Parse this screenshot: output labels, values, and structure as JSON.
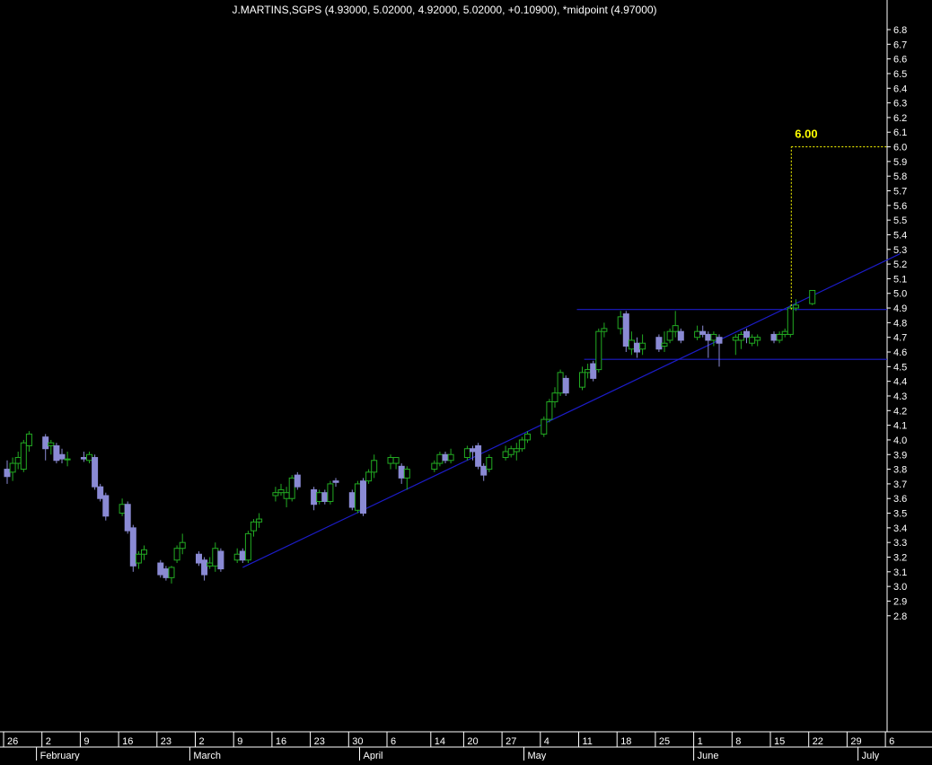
{
  "chart_data": {
    "type": "candlestick",
    "title": "J.MARTINS,SGPS (4.93000, 5.02000, 4.92000, 5.02000, +0.10900), *midpoint (4.97000)",
    "ylim": [
      2.75,
      6.95
    ],
    "yticks": [
      2.8,
      2.9,
      3.0,
      3.1,
      3.2,
      3.3,
      3.4,
      3.5,
      3.6,
      3.7,
      3.8,
      3.9,
      4.0,
      4.1,
      4.2,
      4.3,
      4.4,
      4.5,
      4.6,
      4.7,
      4.8,
      4.9,
      5.0,
      5.1,
      5.2,
      5.3,
      5.4,
      5.5,
      5.6,
      5.7,
      5.8,
      5.9,
      6.0,
      6.1,
      6.2,
      6.3,
      6.4,
      6.5,
      6.6,
      6.7,
      6.8
    ],
    "grid": false,
    "day_labels": [
      "26",
      "2",
      "9",
      "16",
      "23",
      "2",
      "9",
      "16",
      "23",
      "30",
      "6",
      "14",
      "20",
      "27",
      "4",
      "11",
      "18",
      "25",
      "1",
      "8",
      "15",
      "22",
      "29",
      "6"
    ],
    "month_labels": [
      "February",
      "March",
      "April",
      "May",
      "June",
      "July"
    ],
    "colors": {
      "up": "#22aa22",
      "down": "#8a8ad4",
      "trend": "#1c1cc8",
      "target": "#ffff00",
      "axis": "#ffffff"
    },
    "target_label": "6.00",
    "target_value": 6.0,
    "resistance": 4.89,
    "support": 4.55,
    "trendline": {
      "from": [
        "Mar 10",
        3.13
      ],
      "to": [
        "Jul 8",
        5.27
      ]
    },
    "candles": [
      {
        "d": "Jan 26",
        "o": 3.8,
        "h": 3.86,
        "l": 3.7,
        "c": 3.75
      },
      {
        "d": "Jan 27",
        "o": 3.78,
        "h": 3.88,
        "l": 3.72,
        "c": 3.84
      },
      {
        "d": "Jan 28",
        "o": 3.84,
        "h": 3.92,
        "l": 3.8,
        "c": 3.88
      },
      {
        "d": "Jan 29",
        "o": 3.8,
        "h": 4.0,
        "l": 3.78,
        "c": 3.98
      },
      {
        "d": "Jan 30",
        "o": 3.96,
        "h": 4.06,
        "l": 3.92,
        "c": 4.04
      },
      {
        "d": "Feb 2",
        "o": 4.02,
        "h": 4.04,
        "l": 3.86,
        "c": 3.94
      },
      {
        "d": "Feb 3",
        "o": 3.96,
        "h": 4.0,
        "l": 3.9,
        "c": 3.98
      },
      {
        "d": "Feb 4",
        "o": 3.96,
        "h": 3.98,
        "l": 3.84,
        "c": 3.86
      },
      {
        "d": "Feb 5",
        "o": 3.9,
        "h": 3.94,
        "l": 3.84,
        "c": 3.87
      },
      {
        "d": "Feb 6",
        "o": 3.87,
        "h": 3.92,
        "l": 3.82,
        "c": 3.87
      },
      {
        "d": "Feb 9",
        "o": 3.88,
        "h": 3.92,
        "l": 3.85,
        "c": 3.87
      },
      {
        "d": "Feb 10",
        "o": 3.86,
        "h": 3.92,
        "l": 3.84,
        "c": 3.9
      },
      {
        "d": "Feb 11",
        "o": 3.88,
        "h": 3.9,
        "l": 3.66,
        "c": 3.68
      },
      {
        "d": "Feb 12",
        "o": 3.68,
        "h": 3.7,
        "l": 3.58,
        "c": 3.6
      },
      {
        "d": "Feb 13",
        "o": 3.62,
        "h": 3.64,
        "l": 3.45,
        "c": 3.48
      },
      {
        "d": "Feb 16",
        "o": 3.5,
        "h": 3.6,
        "l": 3.48,
        "c": 3.56
      },
      {
        "d": "Feb 17",
        "o": 3.56,
        "h": 3.58,
        "l": 3.36,
        "c": 3.38
      },
      {
        "d": "Feb 18",
        "o": 3.4,
        "h": 3.42,
        "l": 3.1,
        "c": 3.14
      },
      {
        "d": "Feb 19",
        "o": 3.16,
        "h": 3.24,
        "l": 3.12,
        "c": 3.22
      },
      {
        "d": "Feb 20",
        "o": 3.22,
        "h": 3.28,
        "l": 3.18,
        "c": 3.25
      },
      {
        "d": "Feb 23",
        "o": 3.16,
        "h": 3.18,
        "l": 3.06,
        "c": 3.08
      },
      {
        "d": "Feb 24",
        "o": 3.12,
        "h": 3.14,
        "l": 3.04,
        "c": 3.06
      },
      {
        "d": "Feb 25",
        "o": 3.06,
        "h": 3.14,
        "l": 3.02,
        "c": 3.13
      },
      {
        "d": "Feb 26",
        "o": 3.18,
        "h": 3.28,
        "l": 3.16,
        "c": 3.26
      },
      {
        "d": "Feb 27",
        "o": 3.26,
        "h": 3.36,
        "l": 3.22,
        "c": 3.3
      },
      {
        "d": "Mar 2",
        "o": 3.22,
        "h": 3.24,
        "l": 3.14,
        "c": 3.16
      },
      {
        "d": "Mar 3",
        "o": 3.18,
        "h": 3.2,
        "l": 3.04,
        "c": 3.08
      },
      {
        "d": "Mar 4",
        "o": 3.14,
        "h": 3.2,
        "l": 3.12,
        "c": 3.16
      },
      {
        "d": "Mar 5",
        "o": 3.14,
        "h": 3.3,
        "l": 3.1,
        "c": 3.26
      },
      {
        "d": "Mar 6",
        "o": 3.24,
        "h": 3.26,
        "l": 3.1,
        "c": 3.12
      },
      {
        "d": "Mar 9",
        "o": 3.18,
        "h": 3.26,
        "l": 3.16,
        "c": 3.22
      },
      {
        "d": "Mar 10",
        "o": 3.24,
        "h": 3.26,
        "l": 3.16,
        "c": 3.18
      },
      {
        "d": "Mar 11",
        "o": 3.18,
        "h": 3.38,
        "l": 3.16,
        "c": 3.36
      },
      {
        "d": "Mar 12",
        "o": 3.38,
        "h": 3.46,
        "l": 3.34,
        "c": 3.44
      },
      {
        "d": "Mar 13",
        "o": 3.44,
        "h": 3.5,
        "l": 3.4,
        "c": 3.46
      },
      {
        "d": "Mar 16",
        "o": 3.62,
        "h": 3.68,
        "l": 3.58,
        "c": 3.64
      },
      {
        "d": "Mar 17",
        "o": 3.64,
        "h": 3.7,
        "l": 3.62,
        "c": 3.66
      },
      {
        "d": "Mar 18",
        "o": 3.6,
        "h": 3.68,
        "l": 3.54,
        "c": 3.64
      },
      {
        "d": "Mar 19",
        "o": 3.6,
        "h": 3.76,
        "l": 3.58,
        "c": 3.74
      },
      {
        "d": "Mar 20",
        "o": 3.76,
        "h": 3.78,
        "l": 3.66,
        "c": 3.68
      },
      {
        "d": "Mar 23",
        "o": 3.66,
        "h": 3.68,
        "l": 3.52,
        "c": 3.56
      },
      {
        "d": "Mar 24",
        "o": 3.58,
        "h": 3.66,
        "l": 3.56,
        "c": 3.64
      },
      {
        "d": "Mar 25",
        "o": 3.64,
        "h": 3.66,
        "l": 3.56,
        "c": 3.58
      },
      {
        "d": "Mar 26",
        "o": 3.58,
        "h": 3.72,
        "l": 3.56,
        "c": 3.7
      },
      {
        "d": "Mar 27",
        "o": 3.72,
        "h": 3.74,
        "l": 3.68,
        "c": 3.71
      },
      {
        "d": "Mar 30",
        "o": 3.64,
        "h": 3.66,
        "l": 3.52,
        "c": 3.54
      },
      {
        "d": "Mar 31",
        "o": 3.52,
        "h": 3.72,
        "l": 3.5,
        "c": 3.7
      },
      {
        "d": "Apr 1",
        "o": 3.72,
        "h": 3.74,
        "l": 3.48,
        "c": 3.5
      },
      {
        "d": "Apr 2",
        "o": 3.72,
        "h": 3.8,
        "l": 3.7,
        "c": 3.78
      },
      {
        "d": "Apr 3",
        "o": 3.78,
        "h": 3.9,
        "l": 3.74,
        "c": 3.86
      },
      {
        "d": "Apr 6",
        "o": 3.84,
        "h": 3.9,
        "l": 3.8,
        "c": 3.88
      },
      {
        "d": "Apr 7",
        "o": 3.84,
        "h": 3.86,
        "l": 3.8,
        "c": 3.88
      },
      {
        "d": "Apr 8",
        "o": 3.82,
        "h": 3.84,
        "l": 3.7,
        "c": 3.74
      },
      {
        "d": "Apr 9",
        "o": 3.74,
        "h": 3.82,
        "l": 3.66,
        "c": 3.8
      },
      {
        "d": "Apr 14",
        "o": 3.8,
        "h": 3.86,
        "l": 3.78,
        "c": 3.84
      },
      {
        "d": "Apr 15",
        "o": 3.84,
        "h": 3.92,
        "l": 3.82,
        "c": 3.9
      },
      {
        "d": "Apr 16",
        "o": 3.9,
        "h": 3.92,
        "l": 3.84,
        "c": 3.86
      },
      {
        "d": "Apr 17",
        "o": 3.86,
        "h": 3.94,
        "l": 3.84,
        "c": 3.9
      },
      {
        "d": "Apr 20",
        "o": 3.88,
        "h": 3.96,
        "l": 3.86,
        "c": 3.94
      },
      {
        "d": "Apr 21",
        "o": 3.94,
        "h": 3.96,
        "l": 3.86,
        "c": 3.92
      },
      {
        "d": "Apr 22",
        "o": 3.96,
        "h": 3.98,
        "l": 3.8,
        "c": 3.82
      },
      {
        "d": "Apr 23",
        "o": 3.82,
        "h": 3.84,
        "l": 3.72,
        "c": 3.76
      },
      {
        "d": "Apr 24",
        "o": 3.8,
        "h": 3.9,
        "l": 3.78,
        "c": 3.88
      },
      {
        "d": "Apr 27",
        "o": 3.88,
        "h": 3.96,
        "l": 3.86,
        "c": 3.92
      },
      {
        "d": "Apr 28",
        "o": 3.9,
        "h": 3.96,
        "l": 3.88,
        "c": 3.94
      },
      {
        "d": "Apr 29",
        "o": 3.92,
        "h": 3.98,
        "l": 3.86,
        "c": 3.94
      },
      {
        "d": "Apr 30",
        "o": 3.94,
        "h": 4.02,
        "l": 3.92,
        "c": 4.0
      },
      {
        "d": "May 1",
        "o": 4.0,
        "h": 4.06,
        "l": 3.98,
        "c": 4.04
      },
      {
        "d": "May 4",
        "o": 4.04,
        "h": 4.16,
        "l": 4.02,
        "c": 4.14
      },
      {
        "d": "May 5",
        "o": 4.14,
        "h": 4.28,
        "l": 4.12,
        "c": 4.26
      },
      {
        "d": "May 6",
        "o": 4.26,
        "h": 4.36,
        "l": 4.22,
        "c": 4.32
      },
      {
        "d": "May 7",
        "o": 4.32,
        "h": 4.48,
        "l": 4.3,
        "c": 4.46
      },
      {
        "d": "May 8",
        "o": 4.42,
        "h": 4.44,
        "l": 4.3,
        "c": 4.32
      },
      {
        "d": "May 11",
        "o": 4.36,
        "h": 4.5,
        "l": 4.34,
        "c": 4.46
      },
      {
        "d": "May 12",
        "o": 4.46,
        "h": 4.52,
        "l": 4.42,
        "c": 4.48
      },
      {
        "d": "May 13",
        "o": 4.52,
        "h": 4.54,
        "l": 4.4,
        "c": 4.42
      },
      {
        "d": "May 14",
        "o": 4.48,
        "h": 4.76,
        "l": 4.46,
        "c": 4.74
      },
      {
        "d": "May 15",
        "o": 4.74,
        "h": 4.8,
        "l": 4.7,
        "c": 4.76
      },
      {
        "d": "May 18",
        "o": 4.76,
        "h": 4.88,
        "l": 4.72,
        "c": 4.84
      },
      {
        "d": "May 19",
        "o": 4.86,
        "h": 4.88,
        "l": 4.6,
        "c": 4.64
      },
      {
        "d": "May 20",
        "o": 4.62,
        "h": 4.74,
        "l": 4.58,
        "c": 4.68
      },
      {
        "d": "May 21",
        "o": 4.66,
        "h": 4.7,
        "l": 4.56,
        "c": 4.6
      },
      {
        "d": "May 22",
        "o": 4.62,
        "h": 4.72,
        "l": 4.58,
        "c": 4.66
      },
      {
        "d": "May 25",
        "o": 4.7,
        "h": 4.72,
        "l": 4.6,
        "c": 4.62
      },
      {
        "d": "May 26",
        "o": 4.64,
        "h": 4.74,
        "l": 4.6,
        "c": 4.66
      },
      {
        "d": "May 27",
        "o": 4.68,
        "h": 4.76,
        "l": 4.66,
        "c": 4.74
      },
      {
        "d": "May 28",
        "o": 4.74,
        "h": 4.88,
        "l": 4.7,
        "c": 4.78
      },
      {
        "d": "May 29",
        "o": 4.74,
        "h": 4.76,
        "l": 4.66,
        "c": 4.68
      },
      {
        "d": "Jun 1",
        "o": 4.7,
        "h": 4.78,
        "l": 4.68,
        "c": 4.74
      },
      {
        "d": "Jun 2",
        "o": 4.74,
        "h": 4.78,
        "l": 4.7,
        "c": 4.72
      },
      {
        "d": "Jun 3",
        "o": 4.72,
        "h": 4.74,
        "l": 4.56,
        "c": 4.68
      },
      {
        "d": "Jun 4",
        "o": 4.68,
        "h": 4.74,
        "l": 4.64,
        "c": 4.72
      },
      {
        "d": "Jun 5",
        "o": 4.7,
        "h": 4.72,
        "l": 4.5,
        "c": 4.66
      },
      {
        "d": "Jun 8",
        "o": 4.68,
        "h": 4.72,
        "l": 4.58,
        "c": 4.7
      },
      {
        "d": "Jun 9",
        "o": 4.68,
        "h": 4.74,
        "l": 4.62,
        "c": 4.72
      },
      {
        "d": "Jun 10",
        "o": 4.74,
        "h": 4.76,
        "l": 4.66,
        "c": 4.7
      },
      {
        "d": "Jun 11",
        "o": 4.66,
        "h": 4.72,
        "l": 4.64,
        "c": 4.7
      },
      {
        "d": "Jun 12",
        "o": 4.68,
        "h": 4.72,
        "l": 4.64,
        "c": 4.7
      },
      {
        "d": "Jun 15",
        "o": 4.72,
        "h": 4.74,
        "l": 4.66,
        "c": 4.68
      },
      {
        "d": "Jun 16",
        "o": 4.68,
        "h": 4.74,
        "l": 4.66,
        "c": 4.72
      },
      {
        "d": "Jun 17",
        "o": 4.72,
        "h": 4.76,
        "l": 4.7,
        "c": 4.74
      },
      {
        "d": "Jun 18",
        "o": 4.72,
        "h": 4.92,
        "l": 4.7,
        "c": 4.9
      },
      {
        "d": "Jun 19",
        "o": 4.9,
        "h": 4.96,
        "l": 4.88,
        "c": 4.92
      },
      {
        "d": "Jun 22",
        "o": 4.93,
        "h": 5.02,
        "l": 4.92,
        "c": 5.02
      }
    ]
  }
}
